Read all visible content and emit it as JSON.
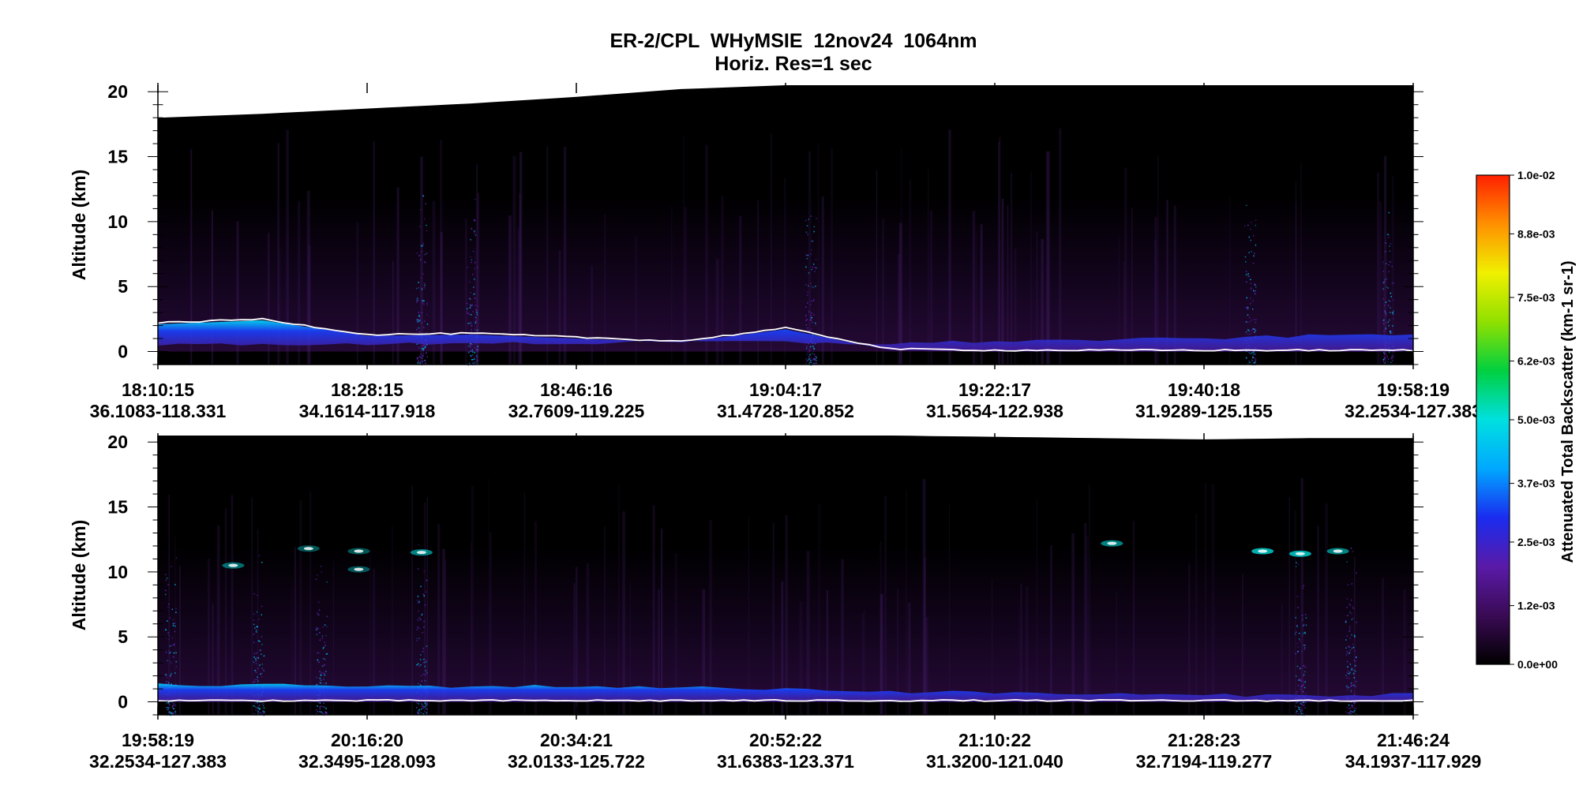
{
  "title": "ER-2/CPL  WHyMSIE  12nov24  1064nm",
  "subtitle": "Horiz. Res=1 sec",
  "colors": {
    "background": "#ffffff",
    "plot_background": "#000000",
    "ground_line": "#ffffff",
    "colormap": [
      "#000000",
      "#3a0a55",
      "#5a1aa8",
      "#1a2cf0",
      "#00a8ff",
      "#00e0e0",
      "#00d040",
      "#90e000",
      "#f0f000",
      "#ff9000",
      "#ff2000"
    ]
  },
  "chart_data": [
    {
      "type": "heatmap",
      "panel": "top",
      "ylabel": "Altitude (km)",
      "ylim": [
        -1,
        20.5
      ],
      "yticks": [
        0,
        5,
        10,
        15,
        20
      ],
      "xticks": [
        {
          "time": "18:10:15",
          "loc": "36.1083-118.331"
        },
        {
          "time": "18:28:15",
          "loc": "34.1614-117.918"
        },
        {
          "time": "18:46:16",
          "loc": "32.7609-119.225"
        },
        {
          "time": "19:04:17",
          "loc": "31.4728-120.852"
        },
        {
          "time": "19:22:17",
          "loc": "31.5654-122.938"
        },
        {
          "time": "19:40:18",
          "loc": "31.9289-125.155"
        },
        {
          "time": "19:58:19",
          "loc": "32.2534-127.383"
        }
      ],
      "aircraft_altitude_km": [
        18.0,
        18.3,
        18.7,
        19.1,
        19.6,
        20.2,
        20.5,
        20.5,
        20.5,
        20.5,
        20.5,
        20.5,
        20.5
      ],
      "ground_km": [
        2.2,
        2.5,
        1.3,
        1.4,
        1.1,
        0.8,
        1.8,
        0.2,
        0.1,
        0.1,
        0.1,
        0.1,
        0.1
      ],
      "boundary_layer_top_km": [
        0.5,
        0.6,
        0.5,
        0.7,
        0.6,
        0.8,
        0.7,
        0.6,
        0.8,
        0.9,
        1.0,
        1.2,
        1.4
      ]
    },
    {
      "type": "heatmap",
      "panel": "bottom",
      "ylabel": "Altitude (km)",
      "ylim": [
        -1,
        20.5
      ],
      "yticks": [
        0,
        5,
        10,
        15,
        20
      ],
      "xticks": [
        {
          "time": "19:58:19",
          "loc": "32.2534-127.383"
        },
        {
          "time": "20:16:20",
          "loc": "32.3495-128.093"
        },
        {
          "time": "20:34:21",
          "loc": "32.0133-125.722"
        },
        {
          "time": "20:52:22",
          "loc": "31.6383-123.371"
        },
        {
          "time": "21:10:22",
          "loc": "31.3200-121.040"
        },
        {
          "time": "21:28:23",
          "loc": "32.7194-119.277"
        },
        {
          "time": "21:46:24",
          "loc": "34.1937-117.929"
        }
      ],
      "aircraft_altitude_km": [
        20.5,
        20.5,
        20.5,
        20.5,
        20.5,
        20.5,
        20.5,
        20.5,
        20.4,
        20.3,
        20.2,
        20.3,
        20.3
      ],
      "ground_km": [
        0.1,
        0.1,
        0.1,
        0.1,
        0.1,
        0.1,
        0.1,
        0.1,
        0.1,
        0.1,
        0.1,
        0.1,
        0.1
      ],
      "boundary_layer_top_km": [
        1.3,
        1.3,
        1.2,
        1.2,
        1.2,
        1.1,
        1.0,
        0.8,
        0.7,
        0.6,
        0.5,
        0.5,
        0.6
      ],
      "cirrus_features": [
        {
          "time_frac": 0.06,
          "alt_km": 10.5,
          "intensity": 0.5
        },
        {
          "time_frac": 0.12,
          "alt_km": 11.8,
          "intensity": 0.4
        },
        {
          "time_frac": 0.16,
          "alt_km": 11.6,
          "intensity": 0.4
        },
        {
          "time_frac": 0.16,
          "alt_km": 10.2,
          "intensity": 0.4
        },
        {
          "time_frac": 0.21,
          "alt_km": 11.5,
          "intensity": 0.6
        },
        {
          "time_frac": 0.76,
          "alt_km": 12.2,
          "intensity": 0.6
        },
        {
          "time_frac": 0.88,
          "alt_km": 11.6,
          "intensity": 0.8
        },
        {
          "time_frac": 0.91,
          "alt_km": 11.4,
          "intensity": 0.8
        },
        {
          "time_frac": 0.94,
          "alt_km": 11.6,
          "intensity": 0.6
        }
      ]
    }
  ],
  "colorbar": {
    "label": "Attenuated Total Backscatter (km-1 sr-1)",
    "ticks": [
      {
        "value": 0.01,
        "label": "1.0e-02"
      },
      {
        "value": 0.0088,
        "label": "8.8e-03"
      },
      {
        "value": 0.0075,
        "label": "7.5e-03"
      },
      {
        "value": 0.0062,
        "label": "6.2e-03"
      },
      {
        "value": 0.005,
        "label": "5.0e-03"
      },
      {
        "value": 0.0037,
        "label": "3.7e-03"
      },
      {
        "value": 0.0025,
        "label": "2.5e-03"
      },
      {
        "value": 0.0012,
        "label": "1.2e-03"
      },
      {
        "value": 0.0,
        "label": "0.0e+00"
      }
    ],
    "range": [
      0,
      0.01
    ]
  }
}
